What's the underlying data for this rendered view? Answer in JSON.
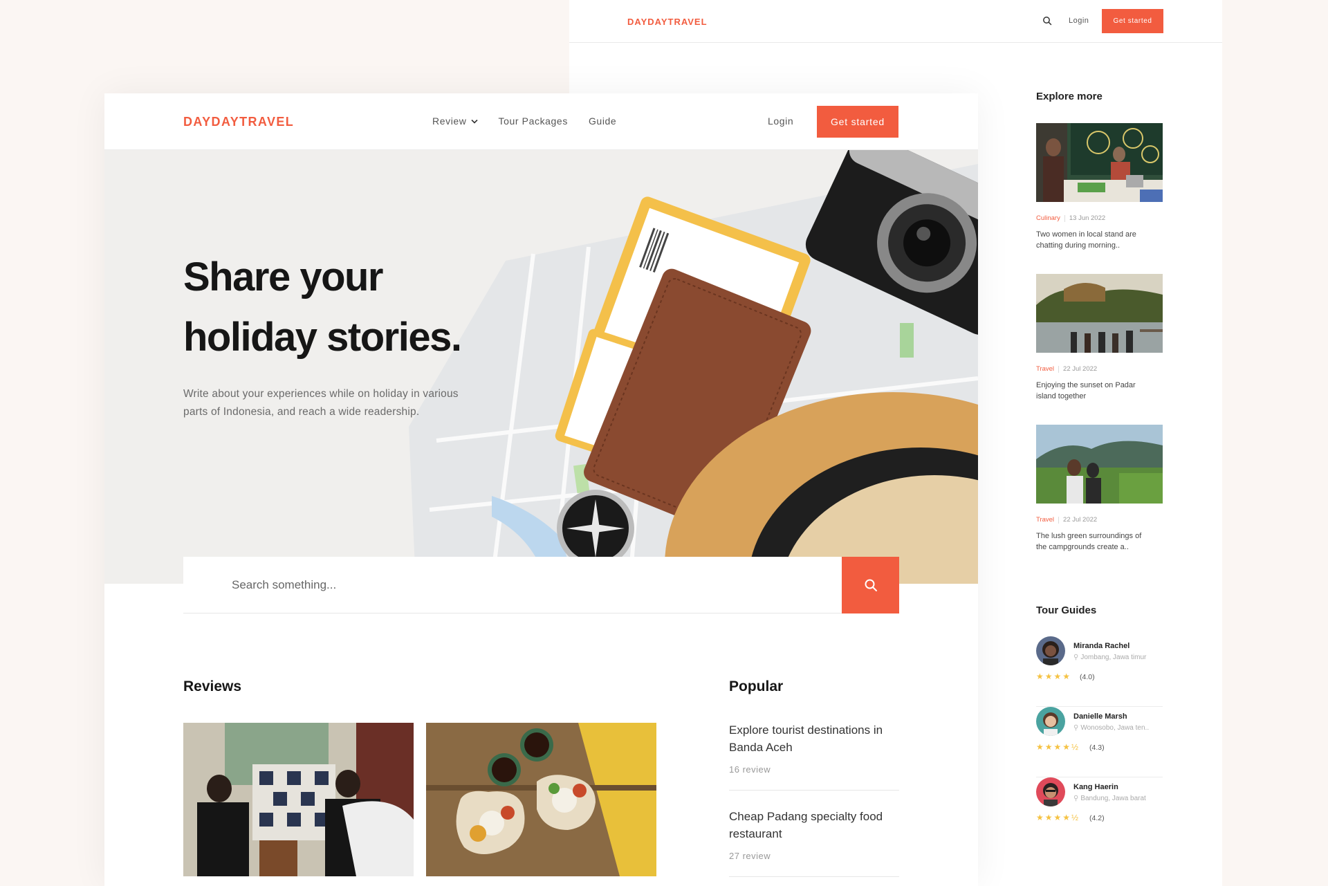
{
  "back_page": {
    "logo": "DAYDAYTRAVEL",
    "login": "Login",
    "cta": "Get started",
    "explore": {
      "title": "Explore more",
      "items": [
        {
          "category": "Culinary",
          "date": "13 Jun 2022",
          "text": "Two women in local stand are chatting during morning.."
        },
        {
          "category": "Travel",
          "date": "22 Jul 2022",
          "text": "Enjoying the sunset on Padar island together"
        },
        {
          "category": "Travel",
          "date": "22 Jul 2022",
          "text": "The lush green surroundings of the campgrounds create a.."
        }
      ]
    },
    "guides": {
      "title": "Tour Guides",
      "items": [
        {
          "name": "Miranda Rachel",
          "location": "Jombang, Jawa timur",
          "stars": "★★★★",
          "score": "(4.0)"
        },
        {
          "name": "Danielle Marsh",
          "location": "Wonosobo, Jawa ten..",
          "stars": "★★★★½",
          "score": "(4.3)"
        },
        {
          "name": "Kang Haerin",
          "location": "Bandung, Jawa barat",
          "stars": "★★★★½",
          "score": "(4.2)"
        }
      ]
    }
  },
  "front_page": {
    "logo": "DAYDAYTRAVEL",
    "menu": [
      "Review",
      "Tour Packages",
      "Guide"
    ],
    "login": "Login",
    "cta": "Get started",
    "hero": {
      "title_line1": "Share your",
      "title_line2": "holiday stories.",
      "subtitle": "Write about your experiences while on holiday in various parts of Indonesia, and reach a wide readership."
    },
    "search": {
      "placeholder": "Search something..."
    },
    "reviews": {
      "title": "Reviews"
    },
    "popular": {
      "title": "Popular",
      "items": [
        {
          "title": "Explore tourist destinations in Banda Aceh",
          "count": "16 review"
        },
        {
          "title": "Cheap Padang specialty food restaurant",
          "count": "27 review"
        }
      ]
    }
  },
  "colors": {
    "accent": "#f25c3f",
    "star": "#f5c242"
  }
}
